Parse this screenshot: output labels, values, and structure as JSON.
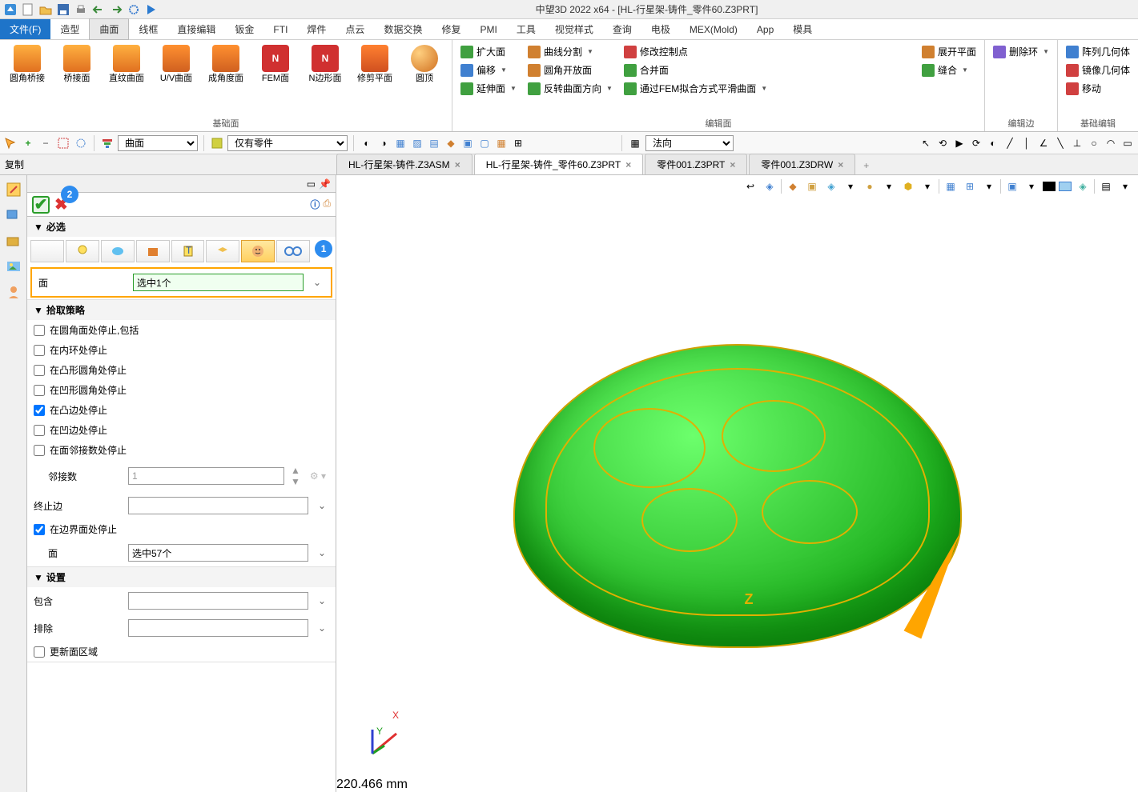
{
  "app": {
    "title": "中望3D 2022 x64 - [HL-行星架-铸件_零件60.Z3PRT]"
  },
  "menu": {
    "file": "文件(F)",
    "items": [
      "造型",
      "曲面",
      "线框",
      "直接编辑",
      "钣金",
      "FTI",
      "焊件",
      "点云",
      "数据交换",
      "修复",
      "PMI",
      "工具",
      "视觉样式",
      "查询",
      "电极",
      "MEX(Mold)",
      "App",
      "模具"
    ]
  },
  "ribbon": {
    "group_base": {
      "label": "基础面",
      "items": [
        "圆角桥接",
        "桥接面",
        "直纹曲面",
        "U/V曲面",
        "成角度面",
        "FEM面",
        "N边形面",
        "修剪平面",
        "圆顶"
      ]
    },
    "group_edit_face": {
      "label": "编辑面",
      "col1": [
        "扩大面",
        "偏移",
        "延伸面"
      ],
      "col2": [
        "曲线分割",
        "圆角开放面",
        "反转曲面方向"
      ],
      "col3": [
        "修改控制点",
        "合并面",
        "通过FEM拟合方式平滑曲面"
      ],
      "col4": [
        "展开平面",
        "缝合"
      ]
    },
    "group_edit_edge": {
      "label": "编辑边",
      "items": [
        "删除环"
      ]
    },
    "group_basic_edit": {
      "label": "基础编辑",
      "items": [
        "阵列几何体",
        "镜像几何体",
        "移动"
      ]
    }
  },
  "toolbar": {
    "left_label": "复制",
    "combo1": "曲面",
    "combo2": "仅有零件",
    "combo3": "法向"
  },
  "tabs": [
    {
      "label": "HL-行星架-铸件.Z3ASM",
      "active": false
    },
    {
      "label": "HL-行星架-铸件_零件60.Z3PRT",
      "active": true
    },
    {
      "label": "零件001.Z3PRT",
      "active": false
    },
    {
      "label": "零件001.Z3DRW",
      "active": false
    }
  ],
  "panel": {
    "section_required": "必选",
    "face_label": "面",
    "face_value": "选中1个",
    "section_strategy": "拾取策略",
    "checks": [
      {
        "label": "在圆角面处停止,包括",
        "checked": false
      },
      {
        "label": "在内环处停止",
        "checked": false
      },
      {
        "label": "在凸形圆角处停止",
        "checked": false
      },
      {
        "label": "在凹形圆角处停止",
        "checked": false
      },
      {
        "label": "在凸边处停止",
        "checked": true
      },
      {
        "label": "在凹边处停止",
        "checked": false
      },
      {
        "label": "在面邻接数处停止",
        "checked": false
      }
    ],
    "adj_label": "邻接数",
    "adj_value": "1",
    "stop_edge_label": "终止边",
    "boundary_check": {
      "label": "在边界面处停止",
      "checked": true
    },
    "boundary_face_label": "面",
    "boundary_face_value": "选中57个",
    "section_settings": "设置",
    "include_label": "包含",
    "exclude_label": "排除",
    "update_region": {
      "label": "更新面区域",
      "checked": false
    },
    "badge1": "1",
    "badge2": "2"
  },
  "viewport": {
    "axis_z": "Z",
    "axis_x": "X",
    "axis_y": "Y",
    "readout": "220.466 mm"
  }
}
